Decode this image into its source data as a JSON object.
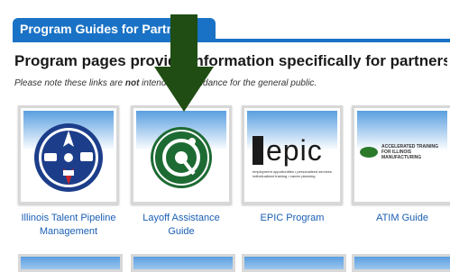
{
  "section": {
    "tab_title": "Program Guides for Partners",
    "heading": "Program pages provide information specifically for partners.",
    "note_prefix": "Please note these links are ",
    "note_emphasis": "not",
    "note_suffix": " intended as guidance for the general public."
  },
  "cards": [
    {
      "label": "Illinois Talent Pipeline Management",
      "icon": "talent-pipeline-logo"
    },
    {
      "label": "Layoff Assistance Guide",
      "icon": "layoff-assistance-logo"
    },
    {
      "label": "EPIC Program",
      "icon": "epic-logo",
      "logo_text": "EPIC",
      "sub_lines": [
        "employment opportunities • personalized services",
        "individualized training • career planning"
      ]
    },
    {
      "label": "ATIM Guide",
      "icon": "atim-logo",
      "badge_text": "ACCELERATED TRAINING FOR ILLINOIS MANUFACTURING"
    }
  ],
  "colors": {
    "accent": "#1a72c6",
    "link": "#1a5fb4",
    "arrow": "#1f4d14"
  }
}
